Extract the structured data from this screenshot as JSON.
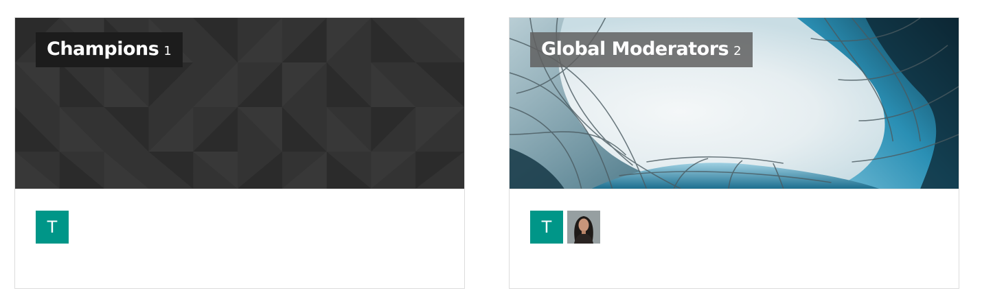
{
  "groups": [
    {
      "title": "Champions",
      "count": "1",
      "cover": "dark-geometric-pattern",
      "members": [
        {
          "type": "initial",
          "initial": "T",
          "color": "#009688"
        }
      ]
    },
    {
      "title": "Global Moderators",
      "count": "2",
      "cover": "glass-building-photo",
      "members": [
        {
          "type": "initial",
          "initial": "T",
          "color": "#009688"
        },
        {
          "type": "photo",
          "icon": "user-photo"
        }
      ]
    }
  ],
  "colors": {
    "avatar_teal": "#009688",
    "dark_cover": "#333333",
    "glass_blue": "#2a8fb4"
  }
}
